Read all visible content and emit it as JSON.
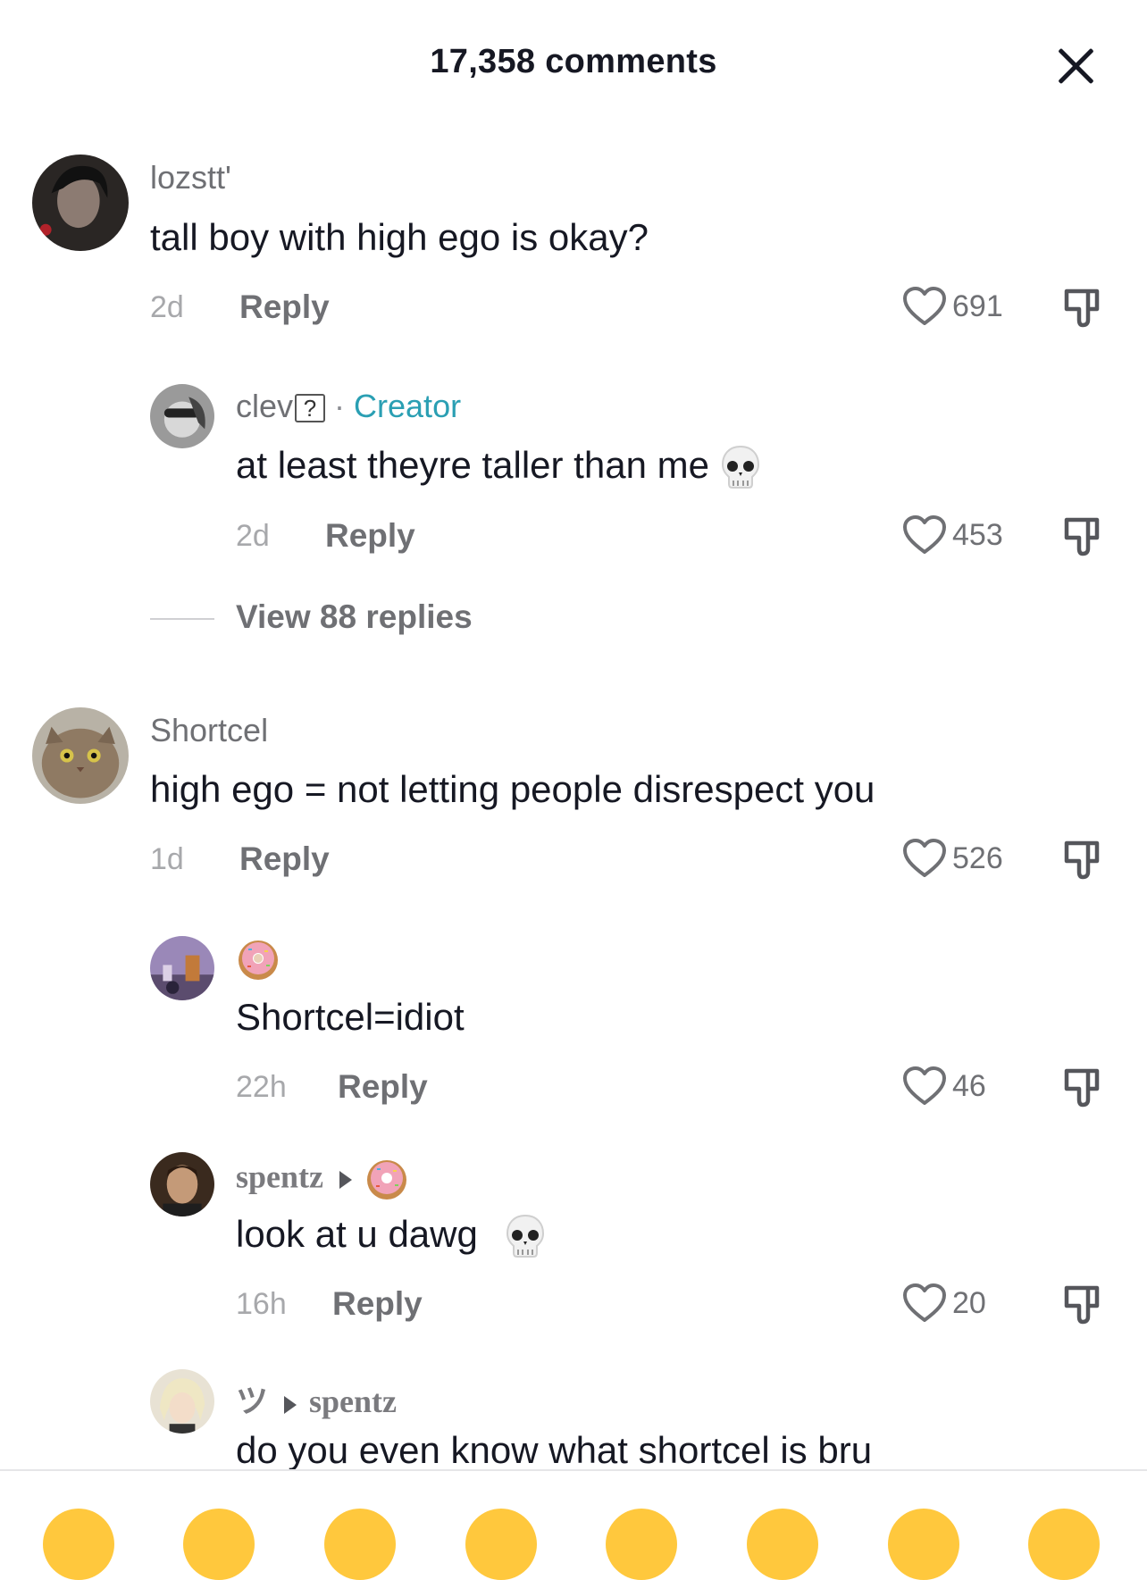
{
  "header": {
    "title": "17,358 comments"
  },
  "comments": [
    {
      "username": "lozstt'",
      "text": "tall boy with high ego is okay?",
      "time": "2d",
      "reply": "Reply",
      "likes": "691"
    },
    {
      "username": "clev",
      "badge": "?",
      "role": "Creator",
      "separator": "·",
      "text": "at least theyre taller than me",
      "emoji": "skull-icon",
      "time": "2d",
      "reply": "Reply",
      "likes": "453"
    },
    {
      "view_replies": "View 88 replies"
    },
    {
      "username": "Shortcel",
      "text": "high ego = not letting people disrespect you",
      "time": "1d",
      "reply": "Reply",
      "likes": "526"
    },
    {
      "username_emoji": "donut-icon",
      "text": "Shortcel=idiot",
      "time": "22h",
      "reply": "Reply",
      "likes": "46"
    },
    {
      "username": "spentz",
      "reply_to_emoji": "donut-icon",
      "text": "look at u dawg",
      "emoji": "skull-icon",
      "time": "16h",
      "reply": "Reply",
      "likes": "20"
    },
    {
      "username": "ツ",
      "reply_to": "spentz",
      "text": "do you even know what shortcel is bru"
    }
  ],
  "colors": {
    "creator": "#2a9fb3",
    "text": "#161823",
    "muted": "#6f7074"
  }
}
